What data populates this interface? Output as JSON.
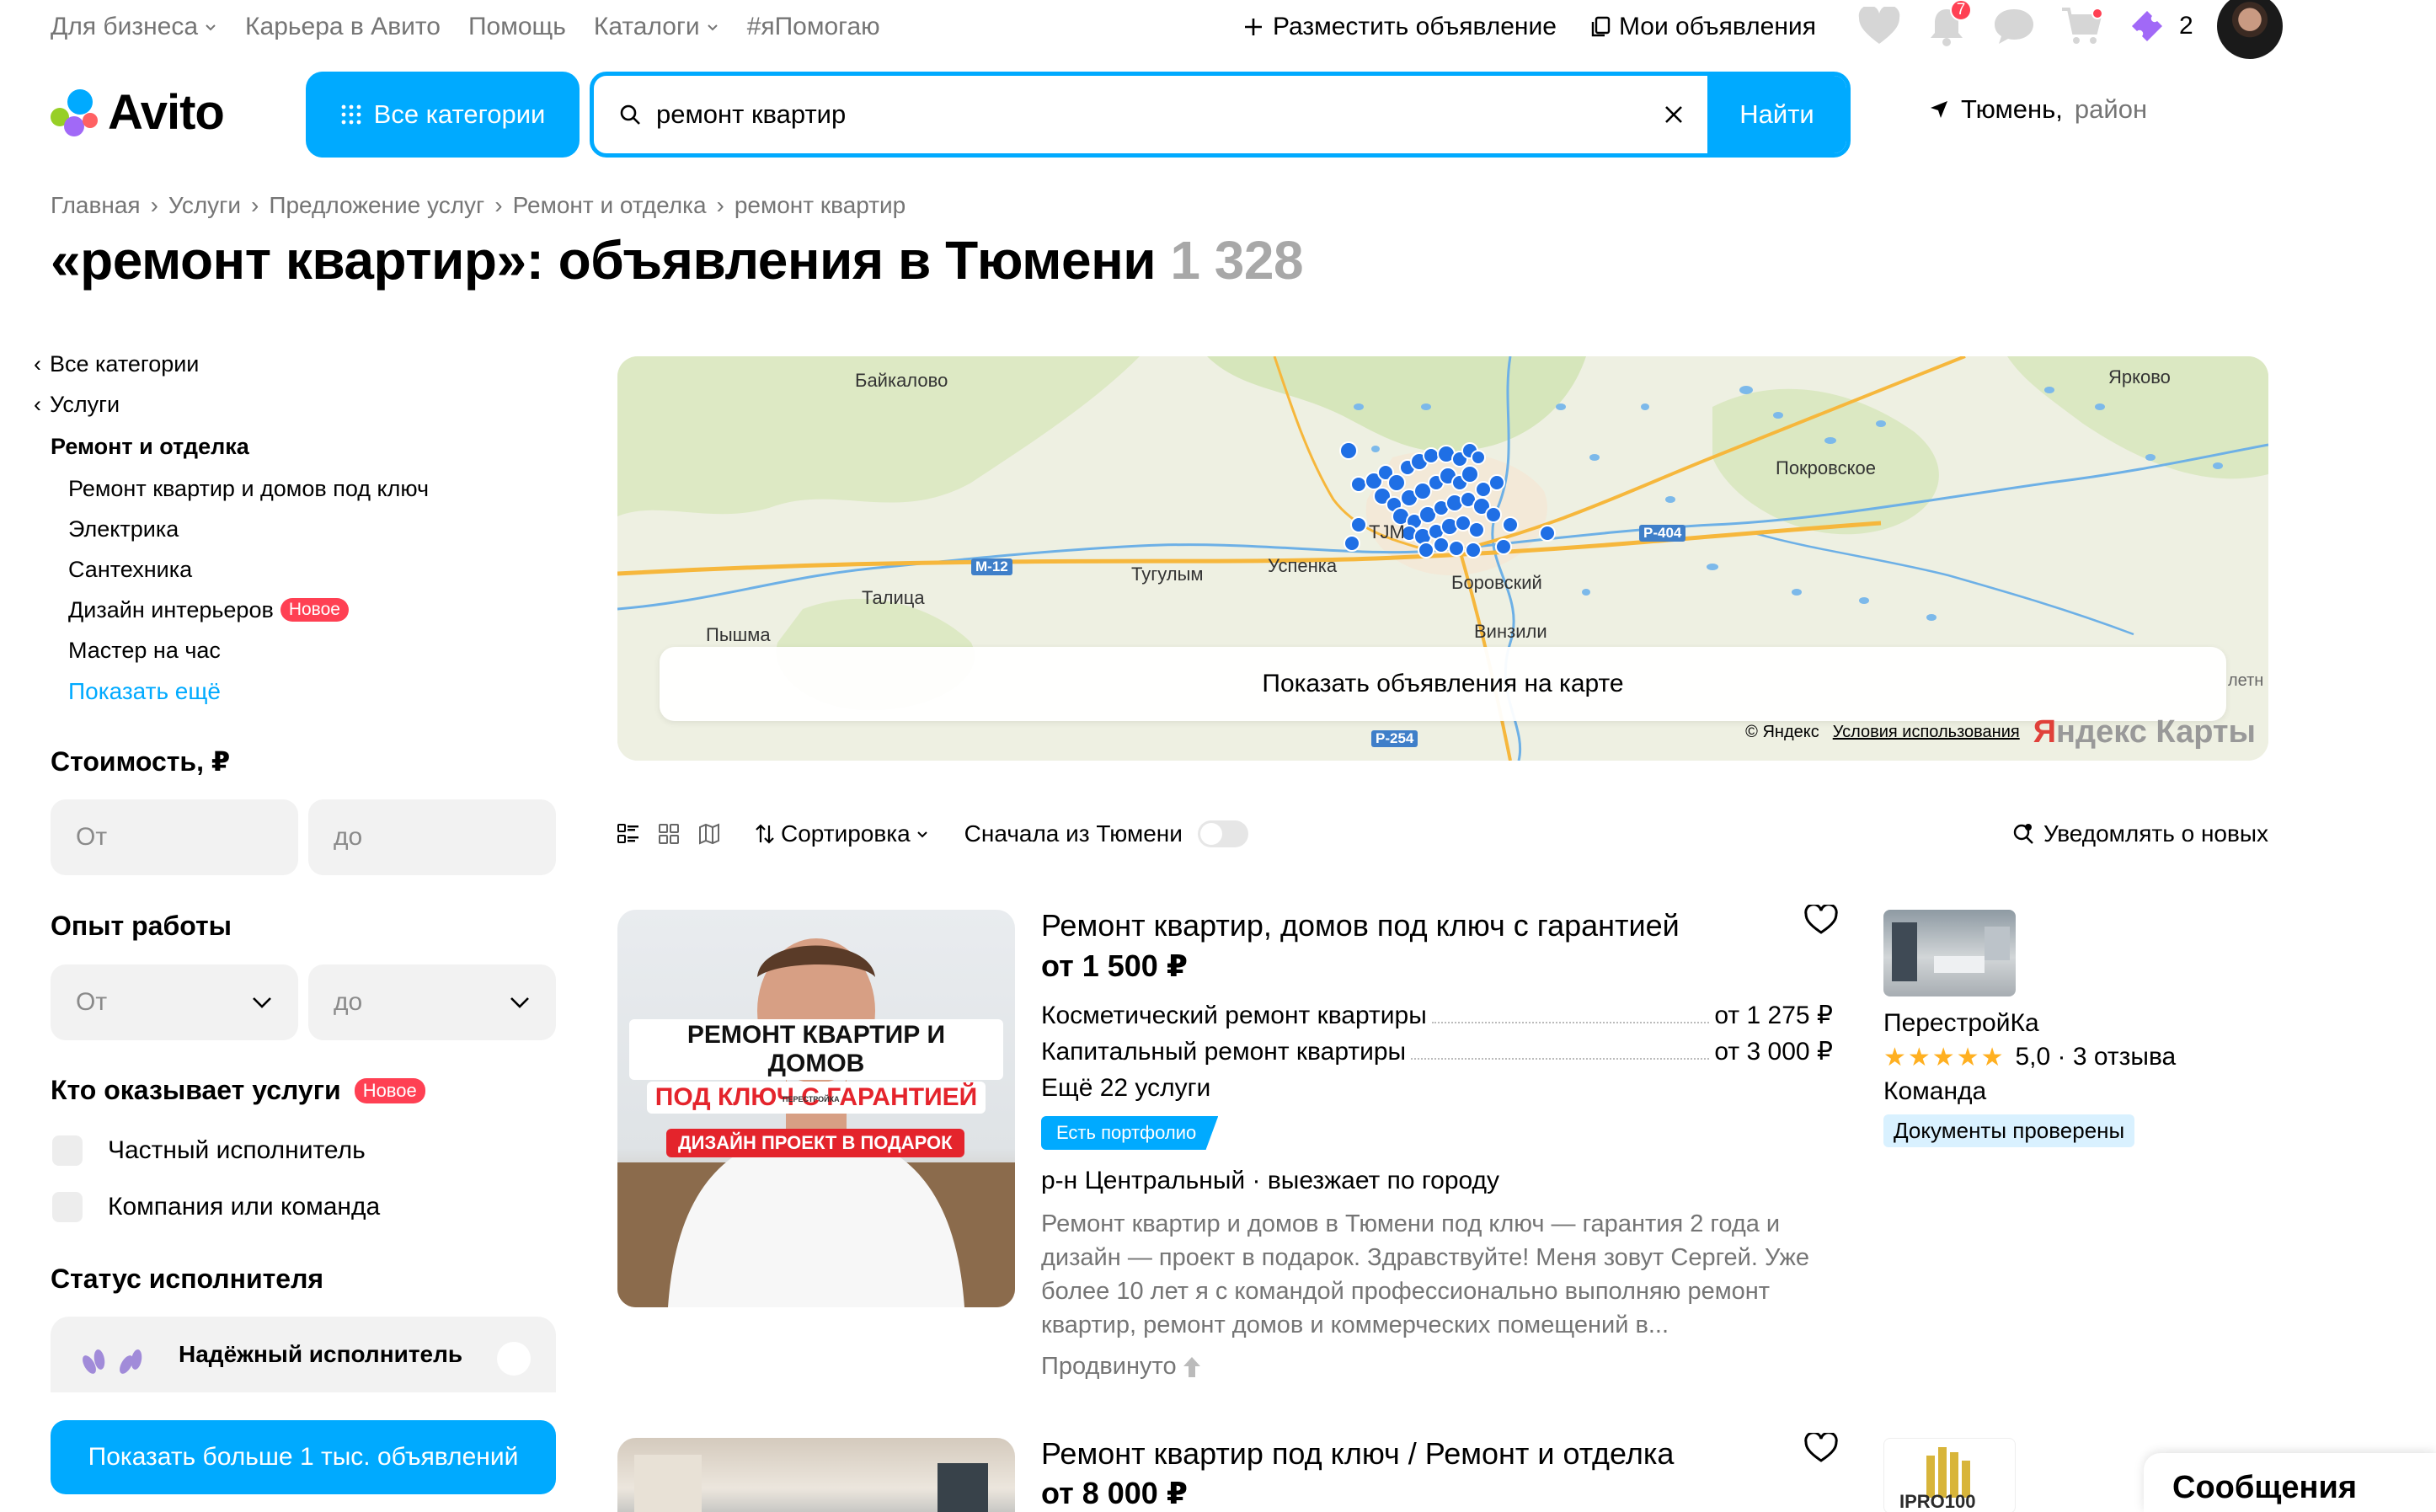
{
  "topnav": {
    "items": [
      {
        "label": "Для бизнеса",
        "dropdown": true
      },
      {
        "label": "Карьера в Авито",
        "dropdown": false
      },
      {
        "label": "Помощь",
        "dropdown": false
      },
      {
        "label": "Каталоги",
        "dropdown": true
      },
      {
        "label": "#яПомогаю",
        "dropdown": false
      }
    ],
    "post_ad": "Разместить объявление",
    "my_ads": "Мои объявления",
    "notifications_count": "7",
    "promo_count": "2"
  },
  "header": {
    "logo": "Avito",
    "all_categories": "Все категории",
    "search_value": "ремонт квартир",
    "search_button": "Найти",
    "location_city": "Тюмень,",
    "location_area": "район"
  },
  "breadcrumbs": [
    "Главная",
    "Услуги",
    "Предложение услуг",
    "Ремонт и отделка",
    "ремонт квартир"
  ],
  "page": {
    "title": "«ремонт квартир»: объявления в Тюмени",
    "count": "1 328"
  },
  "sidebar": {
    "back_all": "Все категории",
    "back_services": "Услуги",
    "current": "Ремонт и отделка",
    "subs": [
      {
        "label": "Ремонт квартир и домов под ключ",
        "new": ""
      },
      {
        "label": "Электрика",
        "new": ""
      },
      {
        "label": "Сантехника",
        "new": ""
      },
      {
        "label": "Дизайн интерьеров",
        "new": "Новое"
      },
      {
        "label": "Мастер на час",
        "new": ""
      }
    ],
    "show_more": "Показать ещё"
  },
  "filters": {
    "price_title": "Стоимость, ₽",
    "price_from": "От",
    "price_to": "до",
    "exp_title": "Опыт работы",
    "exp_from": "От",
    "exp_to": "до",
    "who_title": "Кто оказывает услуги",
    "who_new": "Новое",
    "who_private": "Частный исполнитель",
    "who_company": "Компания или команда",
    "status_title": "Статус исполнителя",
    "reliable": "Надёжный исполнитель",
    "show_button": "Показать больше 1 тыс. объявлений"
  },
  "map": {
    "labels": {
      "baykalovo": "Байкалово",
      "yarkovo": "Ярково",
      "pokrovskoe": "Покровское",
      "tjm": "TJM",
      "uspenka": "Успенка",
      "tugulym": "Тугулым",
      "talitsa": "Талица",
      "borovskiy": "Боровский",
      "pyshma": "Пышма",
      "vinzili": "Винзили",
      "edge": "летн"
    },
    "roads": {
      "m12": "М-12",
      "r404": "Р-404",
      "r254": "Р-254"
    },
    "show_on_map": "Показать объявления на карте",
    "copyright": "© Яндекс",
    "terms": "Условия использования",
    "brand_a": "Я",
    "brand_b": "ндекс Карты"
  },
  "toolbar": {
    "sort": "Сортировка",
    "tyumen_first": "Сначала из Тюмени",
    "notify": "Уведомлять о новых"
  },
  "listings": [
    {
      "photo_line1": "РЕМОНТ КВАРТИР И ДОМОВ",
      "photo_line2": "ПОД КЛЮЧ С ГАРАНТИЕЙ",
      "photo_line3": "ДИЗАЙН ПРОЕКТ В ПОДАРОК",
      "photo_brand": "ПЕРЕСТРОЙКА",
      "title": "Ремонт квартир, домов под ключ с гарантией",
      "price": "от 1 500 ₽",
      "services": [
        {
          "name": "Косметический ремонт квартиры",
          "price": "от 1 275 ₽"
        },
        {
          "name": "Капитальный ремонт квартиры",
          "price": "от 3 000 ₽"
        }
      ],
      "more_services": "Ещё 22 услуги",
      "portfolio": "Есть портфолио",
      "location": "р-н Центральный · выезжает по городу",
      "description": "Ремонт квартир и домов в Тюмени под ключ — гарантия 2 года и дизайн — проект в подарок. Здравствуйте! Меня зовут Сергей. Уже более 10 лет я с командой профессионально выполняю ремонт квартир, ремонт домов и коммерческих помещений в...",
      "promoted": "Продвинуто",
      "seller_name": "ПерестройКа",
      "seller_stars": "★★★★★",
      "seller_rating": "5,0 · 3 отзыва",
      "seller_type": "Команда",
      "seller_verified": "Документы проверены"
    },
    {
      "title": "Ремонт квартир под ключ / Ремонт и отделка",
      "price": "от 8 000 ₽",
      "seller_logo": "IPRO100"
    }
  ],
  "messages": "Сообщения",
  "colors": {
    "accent": "#00aaff",
    "badge": "#ff4053",
    "muted": "#757575",
    "stars": "#ffb021",
    "marker": "#1f6fe5"
  }
}
